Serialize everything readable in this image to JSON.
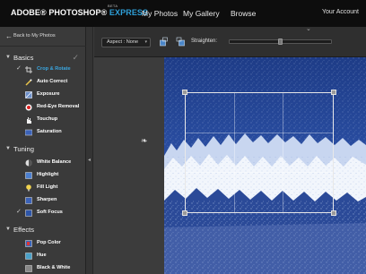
{
  "header": {
    "logo_adobe": "ADOBE® PHOTOSHOP®",
    "logo_express": "EXPRESS",
    "beta": "BETA",
    "nav": [
      "My Photos",
      "My Gallery",
      "Browse"
    ],
    "account": "Your Account"
  },
  "sidebar": {
    "back_label": "Back to My Photos",
    "sections": {
      "basics": "Basics",
      "tuning": "Tuning",
      "effects": "Effects"
    },
    "basics_tools": [
      "Crop & Rotate",
      "Auto Correct",
      "Exposure",
      "Red-Eye Removal",
      "Touchup",
      "Saturation"
    ],
    "tuning_tools": [
      "White Balance",
      "Highlight",
      "Fill Light",
      "Sharpen",
      "Soft Focus"
    ],
    "effects_tools": [
      "Pop Color",
      "Hue",
      "Black & White"
    ]
  },
  "toolbar": {
    "aspect_label": "Aspect : None",
    "straighten_label": "Straighten:"
  },
  "colors": {
    "accent": "#3aa6e0",
    "express": "#2e9fd8",
    "topbar": "#0d0d0d",
    "sidebar": "#3a3a3a"
  }
}
